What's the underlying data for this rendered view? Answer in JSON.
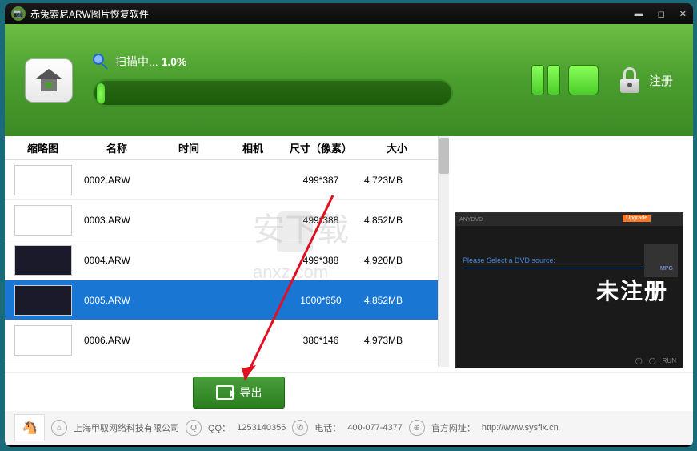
{
  "title": "赤兔索尼ARW图片恢复软件",
  "scan": {
    "label": "扫描中...",
    "percent": "1.0%"
  },
  "register": "注册",
  "headers": {
    "thumb": "缩略图",
    "name": "名称",
    "time": "时间",
    "camera": "相机",
    "size": "尺寸（像素）",
    "fsize": "大小"
  },
  "rows": [
    {
      "name": "0002.ARW",
      "size": "499*387",
      "fsize": "4.723MB",
      "dark": false,
      "selected": false
    },
    {
      "name": "0003.ARW",
      "size": "499*388",
      "fsize": "4.852MB",
      "dark": false,
      "selected": false
    },
    {
      "name": "0004.ARW",
      "size": "499*388",
      "fsize": "4.920MB",
      "dark": true,
      "selected": false
    },
    {
      "name": "0005.ARW",
      "size": "1000*650",
      "fsize": "4.852MB",
      "dark": true,
      "selected": true
    },
    {
      "name": "0006.ARW",
      "size": "380*146",
      "fsize": "4.973MB",
      "dark": false,
      "selected": false
    }
  ],
  "preview": {
    "hint": "Please Select a DVD source:",
    "unreg": "未注册",
    "run": "RUN",
    "mpg": "MPG"
  },
  "export_label": "导出",
  "watermark": "安下载",
  "watermark_url": "anxz.com",
  "footer": {
    "company": "上海甲驭网络科技有限公司",
    "qq_label": "QQ：",
    "qq": "1253140355",
    "tel_label": "电话：",
    "tel": "400-077-4377",
    "site_label": "官方网址：",
    "site": "http://www.sysfix.cn"
  }
}
